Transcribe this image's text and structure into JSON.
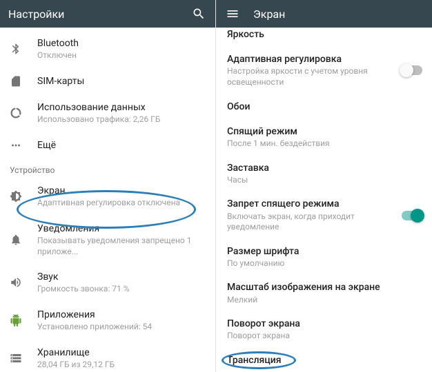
{
  "left": {
    "header_title": "Настройки",
    "section_device": "Устройство",
    "items": {
      "bluetooth": {
        "label": "Bluetooth",
        "sub": "Отключен"
      },
      "sim": {
        "label": "SIM-карты"
      },
      "data": {
        "label": "Использование данных",
        "sub": "Использовано трафика: 2,26 ГБ"
      },
      "more": {
        "label": "Ещё"
      },
      "display": {
        "label": "Экран",
        "sub": "Адаптивная регулировка отключена"
      },
      "notif": {
        "label": "Уведомления",
        "sub": "Показывать уведомления запрещено 1 приложе..."
      },
      "sound": {
        "label": "Звук",
        "sub": "Громкость звонка: 71 %"
      },
      "apps": {
        "label": "Приложения",
        "sub": "Установлено приложений: 54"
      },
      "storage": {
        "label": "Хранилище",
        "sub": "28,04 ГБ из 29,12 ГБ"
      }
    }
  },
  "right": {
    "header_title": "Экран",
    "items": {
      "brightness_cut": {
        "label": "Яркость"
      },
      "adaptive": {
        "label": "Адаптивная регулировка",
        "sub": "Настройка яркости с учетом уровня освещенности",
        "toggle": false
      },
      "wallpaper": {
        "label": "Обои"
      },
      "sleep": {
        "label": "Спящий режим",
        "sub": "После 1 мин. бездействия"
      },
      "saver": {
        "label": "Заставка",
        "sub": "Часы"
      },
      "ambient": {
        "label": "Запрет спящего режима",
        "sub": "Включать экран, когда приходит уведомление",
        "toggle": true
      },
      "fontsize": {
        "label": "Размер шрифта",
        "sub": "По умолчанию"
      },
      "displaysize": {
        "label": "Масштаб изображения на экране",
        "sub": "Мелкий"
      },
      "rotation": {
        "label": "Поворот экрана",
        "sub": "Поворот экрана"
      },
      "cast": {
        "label": "Трансляция"
      }
    }
  }
}
